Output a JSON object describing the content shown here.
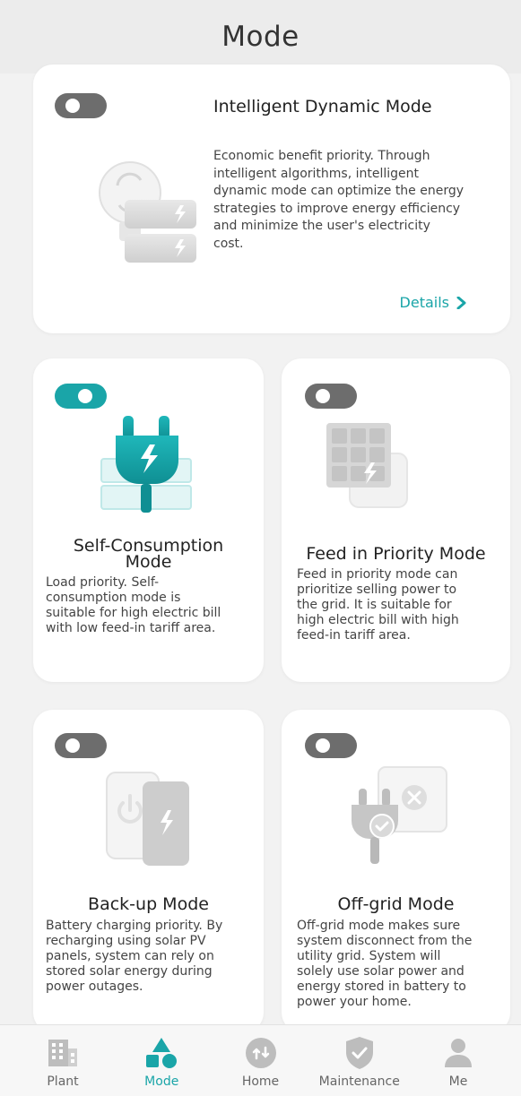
{
  "header": {
    "title": "Mode"
  },
  "colors": {
    "accent": "#1aa5a8",
    "toggle_off": "#6d6d6d",
    "card_bg": "#ffffff",
    "page_bg": "#f2f2f2"
  },
  "modes": {
    "intelligent": {
      "enabled": false,
      "title": "Intelligent Dynamic Mode",
      "desc_lines": [
        "Economic benefit priority. Through",
        "intelligent algorithms, intelligent",
        "dynamic mode can optimize the energy",
        "strategies to improve energy efficiency",
        "and minimize the user's electricity",
        "cost."
      ],
      "details_label": "Details",
      "icon": "bulb-battery-icon"
    },
    "self_consumption": {
      "enabled": true,
      "title_lines": [
        "Self-Consumption",
        "Mode"
      ],
      "desc_lines": [
        "Load priority. Self-",
        "consumption mode is",
        "suitable for high electric bill",
        "with low feed-in tariff area."
      ],
      "icon": "plug-battery-icon"
    },
    "feed_in": {
      "enabled": false,
      "title": "Feed in Priority Mode",
      "desc_lines": [
        "Feed in priority mode can",
        "prioritize selling power to",
        "the grid. It is suitable for",
        "high electric bill with high",
        "feed-in tariff area."
      ],
      "icon": "solar-panel-icon"
    },
    "backup": {
      "enabled": false,
      "title": "Back-up Mode",
      "desc_lines": [
        "Battery charging priority. By",
        "recharging using solar PV",
        "panels, system can rely on",
        "stored solar energy during",
        "power outages."
      ],
      "icon": "power-battery-icon"
    },
    "off_grid": {
      "enabled": false,
      "title": "Off-grid Mode",
      "desc_lines": [
        "Off-grid mode makes sure",
        "system disconnect from the",
        "utility grid. System will",
        "solely use solar power and",
        "energy stored in battery to",
        "power your home."
      ],
      "icon": "plug-grid-off-icon"
    }
  },
  "tabbar": {
    "items": [
      {
        "label": "Plant",
        "icon": "building-icon",
        "active": false
      },
      {
        "label": "Mode",
        "icon": "shapes-icon",
        "active": true
      },
      {
        "label": "Home",
        "icon": "home-sync-icon",
        "active": false
      },
      {
        "label": "Maintenance",
        "icon": "shield-check-icon",
        "active": false
      },
      {
        "label": "Me",
        "icon": "person-icon",
        "active": false
      }
    ]
  }
}
